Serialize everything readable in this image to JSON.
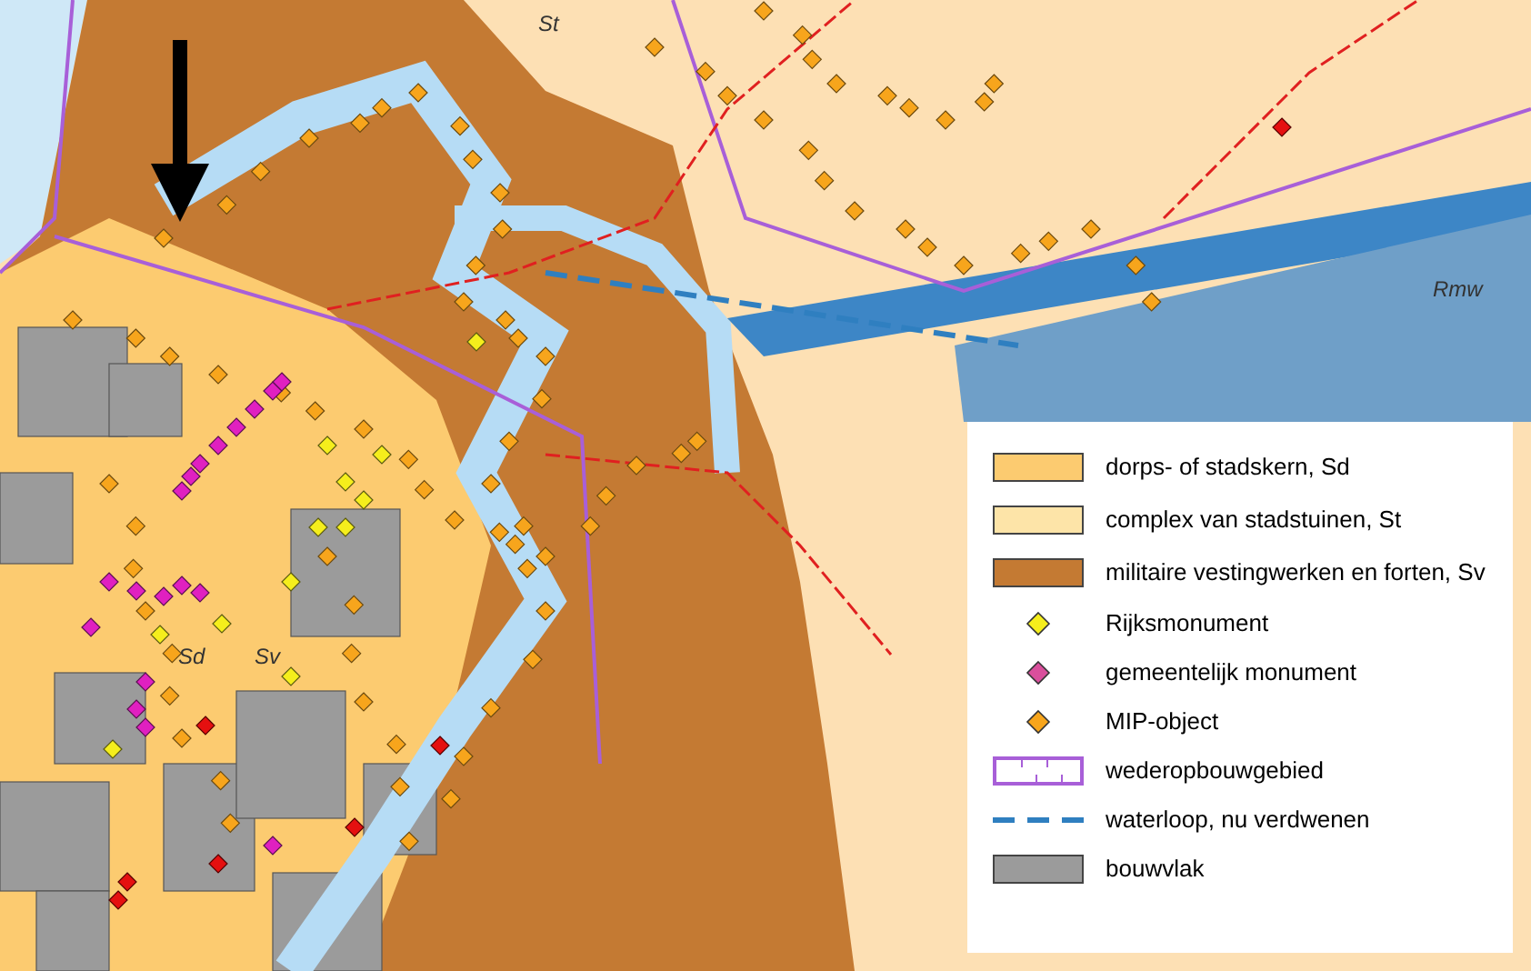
{
  "map_labels": [
    {
      "text": "St"
    },
    {
      "text": "Rmw"
    },
    {
      "text": "Sd"
    },
    {
      "text": "Sv"
    }
  ],
  "legend": {
    "items": [
      {
        "kind": "fill",
        "color": "#fccb70",
        "label": "dorps- of stadskern, Sd"
      },
      {
        "kind": "fill",
        "color": "#fde4a8",
        "label": "complex van stadstuinen, St"
      },
      {
        "kind": "fill",
        "color": "#c47a33",
        "label": "militaire vestingwerken en forten, Sv"
      },
      {
        "kind": "diamond",
        "color": "#f5ee1c",
        "label": "Rijksmonument"
      },
      {
        "kind": "diamond",
        "color": "#d94f9c",
        "label": "gemeentelijk monument"
      },
      {
        "kind": "diamond",
        "color": "#f7a51c",
        "label": "MIP-object"
      },
      {
        "kind": "boundary",
        "color": "#a85fd8",
        "label": "wederopbouwgebied"
      },
      {
        "kind": "dashed",
        "color": "#2f7fc0",
        "label": "waterloop, nu verdwenen"
      },
      {
        "kind": "fill",
        "color": "#9b9b9b",
        "label": "bouwvlak"
      }
    ]
  }
}
